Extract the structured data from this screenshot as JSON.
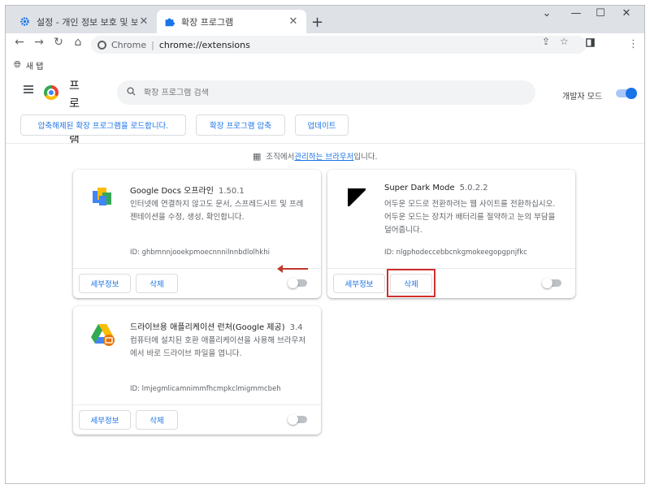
{
  "tabs": [
    {
      "title": "설정 - 개인 정보 보호 및 보안",
      "icon": "gear-icon"
    },
    {
      "title": "확장 프로그램",
      "icon": "puzzle-icon"
    }
  ],
  "window": {
    "minimize": "—",
    "maximize": "☐",
    "close": "✕"
  },
  "omnibox": {
    "site": "Chrome",
    "url": "chrome://extensions"
  },
  "bookmarks": [
    {
      "label": "새 탭"
    }
  ],
  "header": {
    "title": "프로그램",
    "search_placeholder": "확장 프로그램 검색",
    "dev_mode_label": "개발자 모드",
    "dev_mode_on": true
  },
  "actions": {
    "load_unpacked": "압축해제된 확장 프로그램을 로드합니다.",
    "pack": "확장 프로그램 압축",
    "update": "업데이트"
  },
  "managed": {
    "prefix": "조직에서 ",
    "link": "관리하는 브라우저",
    "suffix": "입니다."
  },
  "extensions": [
    {
      "name": "Google Docs 오프라인",
      "version": "1.50.1",
      "description": "인터넷에 연결하지 않고도 문서, 스프레드시트 및 프레젠테이션을 수정, 생성, 확인합니다.",
      "id": "ID: ghbmnnjooekpmoecnnnilnnbdlolhkhi",
      "details": "세부정보",
      "remove": "삭제",
      "enabled": false
    },
    {
      "name": "Super Dark Mode",
      "version": "5.0.2.2",
      "description": "어두운 모드로 전환하려는 웹 사이트를 전환하십시오. 어두운 모드는 장치가 배터리를 절약하고 눈의 부담을 덜어줍니다.",
      "id": "ID: nlgphodeccebbcnkgmokeegopgpnjfkc",
      "details": "세부정보",
      "remove": "삭제",
      "enabled": false
    },
    {
      "name": "드라이브용 애플리케이션 런처(Google 제공)",
      "version": "3.4",
      "description": "컴퓨터에 설치된 호환 애플리케이션을 사용해 브라우저에서 바로 드라이브 파일을 엽니다.",
      "id": "ID: lmjegmlicamnimmfhcmpkclmigmmcbeh",
      "details": "세부정보",
      "remove": "삭제",
      "enabled": false
    }
  ],
  "colors": {
    "accent": "#1a73e8",
    "annotation": "#d32f2f"
  }
}
